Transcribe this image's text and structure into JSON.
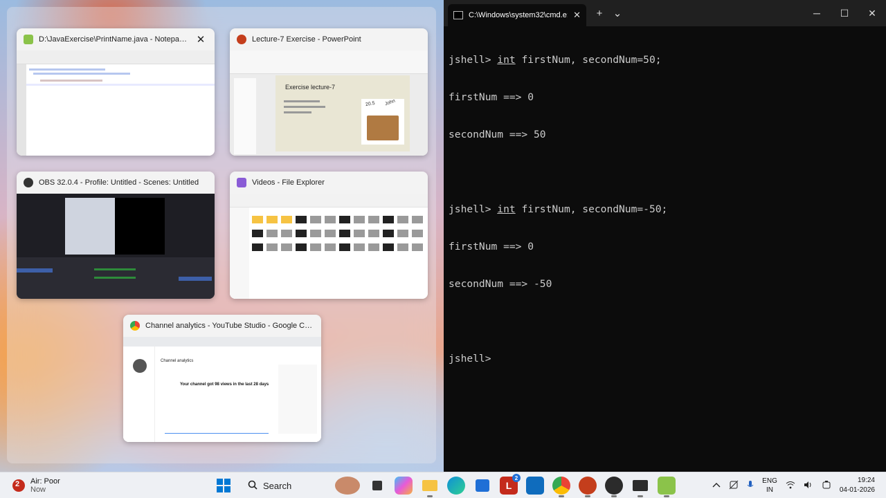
{
  "snap_assist": {
    "windows": [
      {
        "title": "D:\\JavaExercise\\PrintName.java - Notepad++",
        "icon": "notepadpp-icon",
        "show_close": true
      },
      {
        "title": "Lecture-7 Exercise - PowerPoint",
        "icon": "powerpoint-icon"
      },
      {
        "title": "OBS 32.0.4 - Profile: Untitled - Scenes: Untitled",
        "icon": "obs-icon"
      },
      {
        "title": "Videos - File Explorer",
        "icon": "folder-icon"
      },
      {
        "title": "Channel analytics - YouTube Studio - Google Chrome",
        "icon": "chrome-icon"
      }
    ],
    "close_glyph": "✕",
    "ppt_slide_title": "Exercise lecture-7",
    "ppt_box_labels": [
      "20.5",
      "John"
    ],
    "yt_heading": "Channel analytics",
    "yt_summary": "Your channel got 98 views in the last 28 days"
  },
  "terminal": {
    "tab_title": "C:\\Windows\\system32\\cmd.e:",
    "tab_close": "✕",
    "new_tab": "+",
    "dropdown": "⌄",
    "controls": {
      "minimize": "─",
      "maximize": "☐",
      "close": "✕"
    },
    "lines": [
      {
        "prompt": "jshell> ",
        "kw": "int",
        "rest": " firstNum, secondNum=50;"
      },
      {
        "text": "firstNum ==> 0"
      },
      {
        "text": "secondNum ==> 50"
      },
      {
        "text": ""
      },
      {
        "prompt": "jshell> ",
        "kw": "int",
        "rest": " firstNum, secondNum=-50;"
      },
      {
        "text": "firstNum ==> 0"
      },
      {
        "text": "secondNum ==> -50"
      },
      {
        "text": ""
      },
      {
        "text": "jshell>"
      }
    ]
  },
  "taskbar": {
    "weather_title": "Air: Poor",
    "weather_sub": "Now",
    "search_label": "Search",
    "lang_top": "ENG",
    "lang_bottom": "IN",
    "time": "19:24",
    "date": "04-01-2026",
    "badge_count": "2",
    "colors": {
      "accent": "#0078d4",
      "terminal_bg": "#0c0c0c"
    }
  }
}
